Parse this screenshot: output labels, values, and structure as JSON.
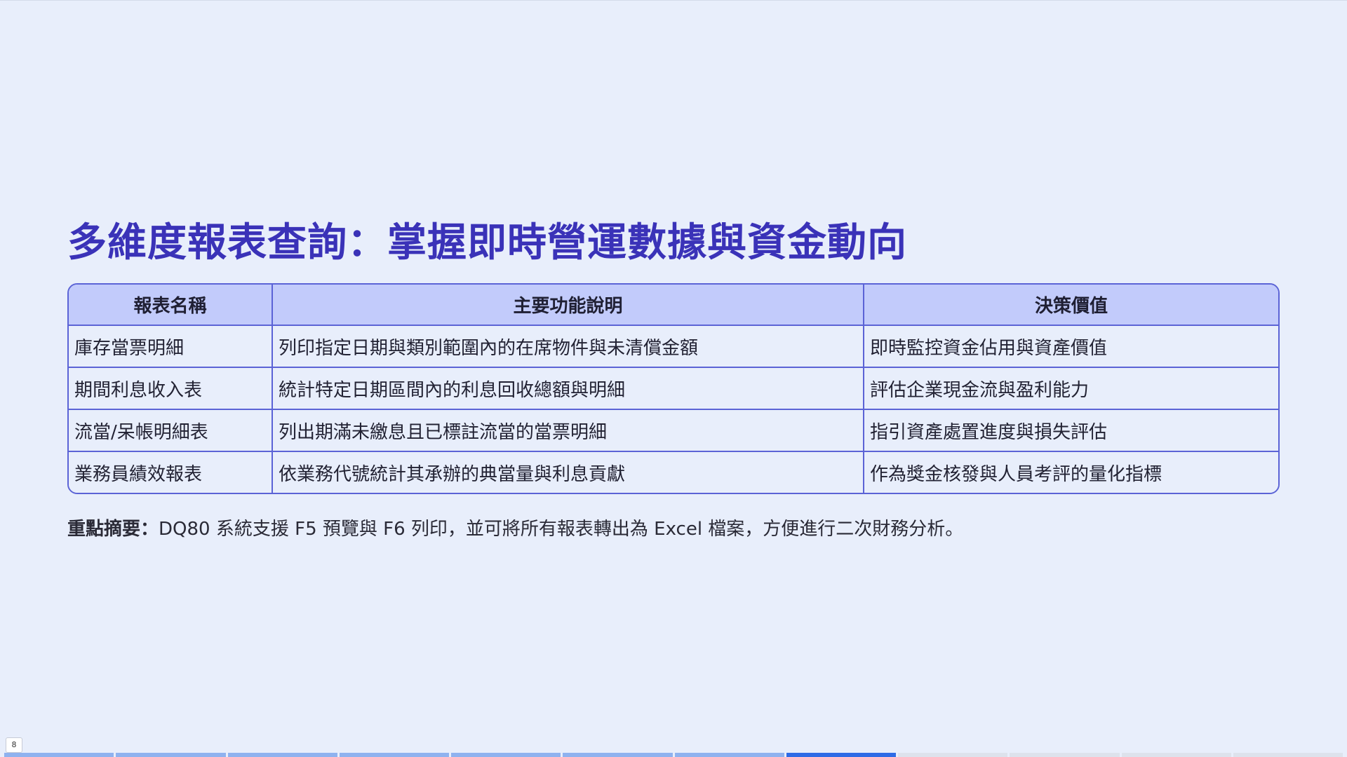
{
  "slide": {
    "title": "多維度報表查詢：掌握即時營運數據與資金動向",
    "page_number": "8"
  },
  "table": {
    "headers": [
      "報表名稱",
      "主要功能說明",
      "決策價值"
    ],
    "rows": [
      [
        "庫存當票明細",
        "列印指定日期與類別範圍內的在席物件與未清償金額",
        "即時監控資金佔用與資產價值"
      ],
      [
        "期間利息收入表",
        "統計特定日期區間內的利息回收總額與明細",
        "評估企業現金流與盈利能力"
      ],
      [
        "流當/呆帳明細表",
        "列出期滿未繳息且已標註流當的當票明細",
        "指引資產處置進度與損失評估"
      ],
      [
        "業務員績效報表",
        "依業務代號統計其承辦的典當量與利息貢獻",
        "作為獎金核發與人員考評的量化指標"
      ]
    ]
  },
  "summary": {
    "label": "重點摘要：",
    "text": "DQ80 系統支援 F5 預覽與 F6 列印，並可將所有報表轉出為 Excel 檔案，方便進行二次財務分析。"
  },
  "progress": {
    "total_slides": 12,
    "current_slide": 8,
    "colors": {
      "done": "#8fb2ef",
      "current": "#2e6be6",
      "pending": "#dde2ec"
    }
  }
}
